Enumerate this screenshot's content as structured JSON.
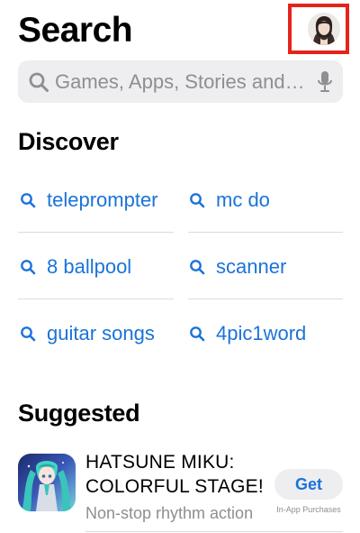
{
  "header": {
    "title": "Search"
  },
  "search": {
    "placeholder": "Games, Apps, Stories and More"
  },
  "discover": {
    "heading": "Discover",
    "items": [
      "teleprompter",
      "mc do",
      "8 ballpool",
      "scanner",
      "guitar songs",
      "4pic1word"
    ]
  },
  "suggested": {
    "heading": "Suggested",
    "app": {
      "title": "HATSUNE MIKU: COLORFUL STAGE!",
      "subtitle": "Non-stop rhythm action",
      "get_label": "Get",
      "iap_label": "In-App Purchases"
    }
  },
  "colors": {
    "accent": "#1a73d9",
    "highlight_border": "#e5231b",
    "secondary_text": "#8e8e93",
    "search_bg": "#eeeef0"
  },
  "icons": [
    "search-icon",
    "microphone-icon",
    "profile-avatar",
    "app-icon"
  ]
}
